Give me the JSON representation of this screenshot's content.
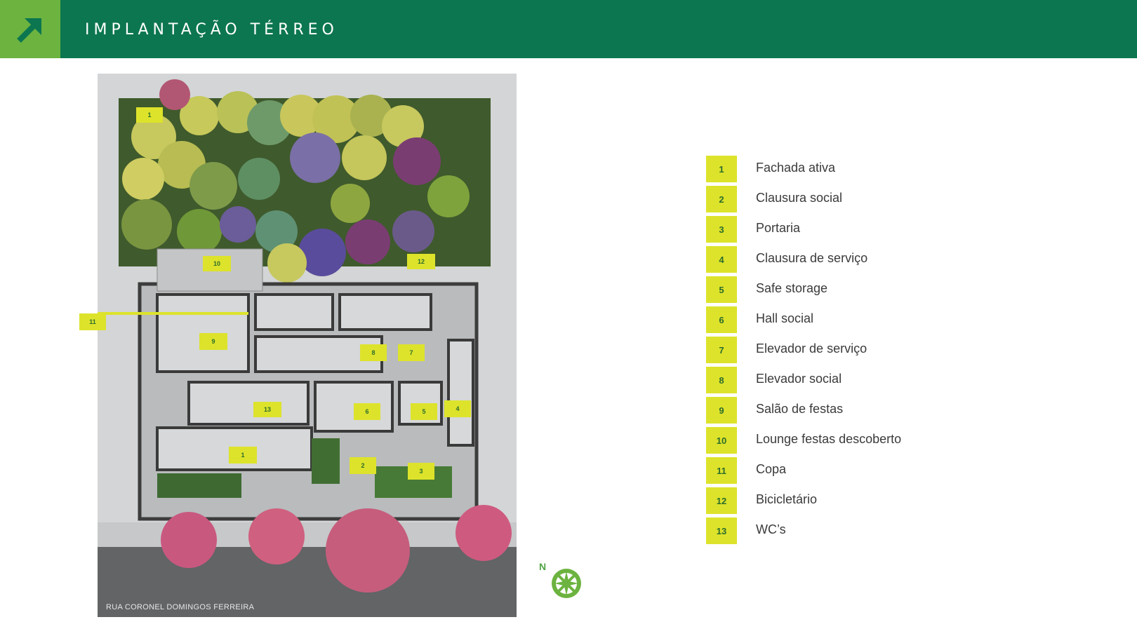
{
  "header": {
    "title": "IMPLANTAÇÃO TÉRREO",
    "accent_color": "#6cb33f",
    "bar_color": "#0c7650",
    "logo_icon": "arrow-up-right-icon"
  },
  "plan": {
    "street_label": "RUA CORONEL DOMINGOS FERREIRA",
    "markers": [
      "1",
      "10",
      "12",
      "11",
      "9",
      "8",
      "7",
      "4",
      "13",
      "6",
      "5",
      "1",
      "2",
      "3"
    ]
  },
  "compass": {
    "north_label": "N",
    "icon": "compass-icon"
  },
  "legend": {
    "marker_color": "#dde32b",
    "items": [
      {
        "num": "1",
        "label": "Fachada ativa"
      },
      {
        "num": "2",
        "label": "Clausura social"
      },
      {
        "num": "3",
        "label": "Portaria"
      },
      {
        "num": "4",
        "label": "Clausura de serviço"
      },
      {
        "num": "5",
        "label": "Safe storage"
      },
      {
        "num": "6",
        "label": "Hall social"
      },
      {
        "num": "7",
        "label": "Elevador de serviço"
      },
      {
        "num": "8",
        "label": "Elevador social"
      },
      {
        "num": "9",
        "label": "Salão de festas"
      },
      {
        "num": "10",
        "label": "Lounge festas descoberto"
      },
      {
        "num": "11",
        "label": "Copa"
      },
      {
        "num": "12",
        "label": "Bicicletário"
      },
      {
        "num": "13",
        "label": "WC’s"
      }
    ]
  }
}
